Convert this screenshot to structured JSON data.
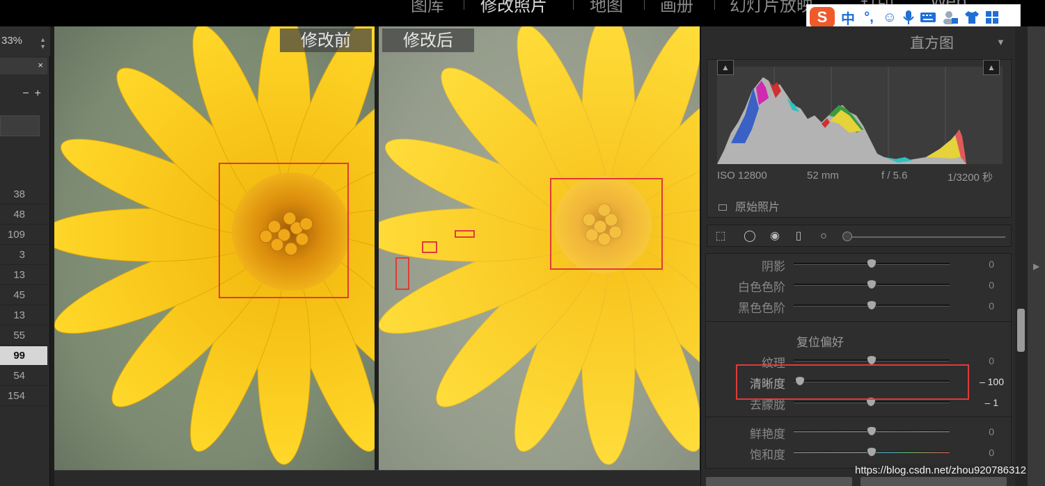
{
  "modules": [
    {
      "label": "图库",
      "active": false
    },
    {
      "label": "修改照片",
      "active": true
    },
    {
      "label": "地图",
      "active": false
    },
    {
      "label": "画册",
      "active": false
    },
    {
      "label": "幻灯片放映",
      "active": false
    },
    {
      "label": "打印",
      "active": false
    },
    {
      "label": "Web",
      "active": false
    }
  ],
  "ime": {
    "logo": "S",
    "mode": "中",
    "punct": "°,",
    "icons": [
      "smile-icon",
      "mic-icon",
      "keyboard-icon",
      "user-icon",
      "shirt-icon",
      "grid-icon"
    ]
  },
  "left_panel": {
    "zoom": "33%",
    "close": "×",
    "minus": "−",
    "plus": "+",
    "values": [
      "38",
      "48",
      "109",
      "3",
      "13",
      "45",
      "13",
      "55",
      "99",
      "54",
      "154"
    ],
    "selected_index": 8
  },
  "photos": {
    "before_label": "修改前",
    "after_label": "修改后"
  },
  "histogram": {
    "title": "直方图",
    "iso": "ISO 12800",
    "focal": "52 mm",
    "aperture": "f / 5.6",
    "shutter": "1/3200 秒",
    "original_label": "原始照片"
  },
  "basic_panel": {
    "tone_sliders": [
      {
        "label": "阴影",
        "value": "0",
        "pos": 0.5
      },
      {
        "label": "白色色阶",
        "value": "0",
        "pos": 0.5
      },
      {
        "label": "黑色色阶",
        "value": "0",
        "pos": 0.5
      }
    ],
    "presence_title": "复位偏好",
    "presence_sliders": [
      {
        "label": "纹理",
        "value": "0",
        "pos": 0.5
      },
      {
        "label": "清晰度",
        "value": "– 100",
        "pos": 0.0
      },
      {
        "label": "去朦胧",
        "value": "– 1",
        "pos": 0.497
      }
    ],
    "color_sliders": [
      {
        "label": "鲜艳度",
        "value": "0",
        "pos": 0.5
      },
      {
        "label": "饱和度",
        "value": "0",
        "pos": 0.5
      }
    ]
  },
  "watermark": "https://blog.csdn.net/zhou920786312",
  "colors": {
    "highlight_red": "#e03a3a",
    "petal_yellow": "#f5c518"
  }
}
